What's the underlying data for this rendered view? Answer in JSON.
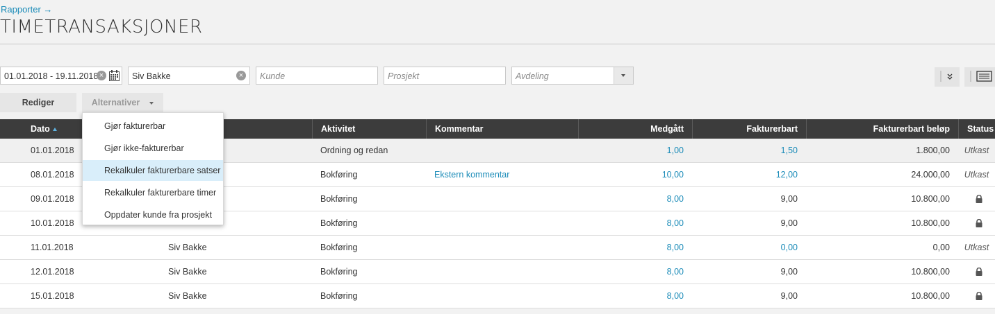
{
  "breadcrumb": "Rapporter →",
  "page_title": "TIMETRANSAKSJONER",
  "filters": {
    "date_range": "01.01.2018 - 19.11.2018",
    "employee": "Siv Bakke",
    "customer_placeholder": "Kunde",
    "project_placeholder": "Prosjekt",
    "department_placeholder": "Avdeling"
  },
  "toolbar": {
    "edit_label": "Rediger",
    "options_label": "Alternativer"
  },
  "options_menu": [
    "Gjør fakturerbar",
    "Gjør ikke-fakturerbar",
    "Rekalkuler fakturerbare satser",
    "Rekalkuler fakturerbare timer",
    "Oppdater kunde fra prosjekt"
  ],
  "options_menu_active_index": 2,
  "table": {
    "headers": {
      "date": "Dato",
      "activity": "Aktivitet",
      "comment": "Kommentar",
      "spent": "Medgått",
      "billable": "Fakturerbart",
      "billable_amount": "Fakturerbart beløp",
      "status": "Status"
    },
    "sort": "date-ascending",
    "rows": [
      {
        "date": "01.01.2018",
        "employee": "",
        "activity": "Ordning og redan",
        "comment": "",
        "spent": "1,00",
        "billable": "1,50",
        "amount": "1.800,00",
        "status": "Utkast",
        "locked": false
      },
      {
        "date": "08.01.2018",
        "employee": "",
        "activity": "Bokføring",
        "comment": "Ekstern kommentar",
        "spent": "10,00",
        "billable": "12,00",
        "amount": "24.000,00",
        "status": "Utkast",
        "locked": false
      },
      {
        "date": "09.01.2018",
        "employee": "",
        "activity": "Bokføring",
        "comment": "",
        "spent": "8,00",
        "billable": "9,00",
        "amount": "10.800,00",
        "status": "",
        "locked": true
      },
      {
        "date": "10.01.2018",
        "employee": "",
        "activity": "Bokføring",
        "comment": "",
        "spent": "8,00",
        "billable": "9,00",
        "amount": "10.800,00",
        "status": "",
        "locked": true
      },
      {
        "date": "11.01.2018",
        "employee": "Siv Bakke",
        "activity": "Bokføring",
        "comment": "",
        "spent": "8,00",
        "billable": "0,00",
        "amount": "0,00",
        "status": "Utkast",
        "locked": false
      },
      {
        "date": "12.01.2018",
        "employee": "Siv Bakke",
        "activity": "Bokføring",
        "comment": "",
        "spent": "8,00",
        "billable": "9,00",
        "amount": "10.800,00",
        "status": "",
        "locked": true
      },
      {
        "date": "15.01.2018",
        "employee": "Siv Bakke",
        "activity": "Bokføring",
        "comment": "",
        "spent": "8,00",
        "billable": "9,00",
        "amount": "10.800,00",
        "status": "",
        "locked": true
      }
    ]
  },
  "colors": {
    "link": "#1a8bb8",
    "header_bg": "#3c3c3c",
    "menu_active": "#d9eefa"
  }
}
